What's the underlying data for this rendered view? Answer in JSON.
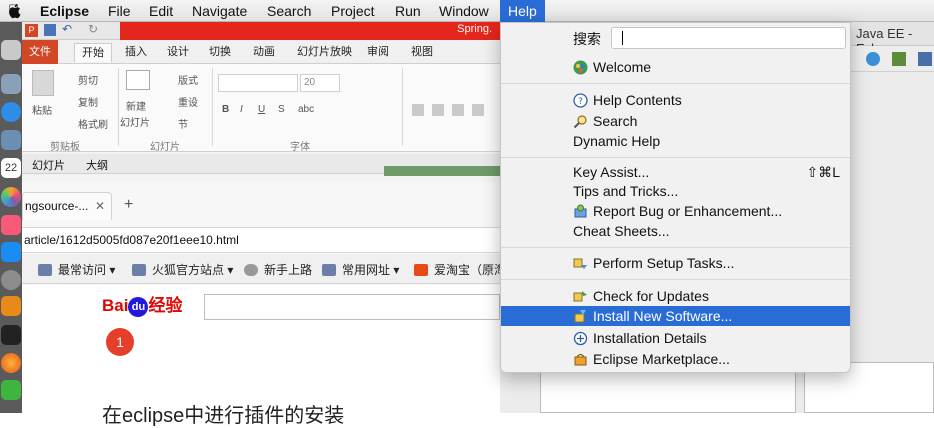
{
  "menubar": {
    "app_name": "Eclipse",
    "items": [
      "File",
      "Edit",
      "Navigate",
      "Search",
      "Project",
      "Run",
      "Window",
      "Help"
    ],
    "active": "Help"
  },
  "ppt": {
    "title_fragment": "Spring.",
    "tabs": [
      "文件",
      "开始",
      "插入",
      "设计",
      "切换",
      "动画",
      "幻灯片放映",
      "审阅",
      "视图"
    ],
    "ribbon": {
      "cut": "剪切",
      "copy": "复制",
      "format_painter": "格式刷",
      "paste": "粘贴",
      "new_slide": "新建",
      "slide_sub": "幻灯片",
      "layout": "版式",
      "reset": "重设",
      "section": "节",
      "font_size": "20",
      "groups": [
        "剪贴板",
        "幻灯片",
        "字体"
      ]
    },
    "panel_tabs": [
      "幻灯片",
      "大纲"
    ]
  },
  "browser": {
    "tab_title": "ngsource-...",
    "url": "article/1612d5005fd087e20f1eee10.html",
    "bookmarks": [
      "最常访问",
      "火狐官方站点",
      "新手上路",
      "常用网址",
      "爱淘宝（原淘"
    ],
    "logo_text": "Bai",
    "logo_du": "du",
    "logo_jingyan": "经验",
    "badge": "1",
    "heading": "在eclipse中进行插件的安装"
  },
  "eclipse": {
    "window_title": "Java EE - Ecl"
  },
  "help_menu": {
    "search_label": "搜索",
    "search_value": "",
    "items": {
      "welcome": "Welcome",
      "help_contents": "Help Contents",
      "search": "Search",
      "dynamic_help": "Dynamic Help",
      "key_assist": "Key Assist...",
      "key_assist_shortcut": "⇧⌘L",
      "tips": "Tips and Tricks...",
      "report_bug": "Report Bug or Enhancement...",
      "cheat_sheets": "Cheat Sheets...",
      "setup_tasks": "Perform Setup Tasks...",
      "check_updates": "Check for Updates",
      "install_software": "Install New Software...",
      "installation_details": "Installation Details",
      "marketplace": "Eclipse Marketplace..."
    },
    "highlighted": "install_software",
    "highlight_color": "#2a6cd6"
  }
}
